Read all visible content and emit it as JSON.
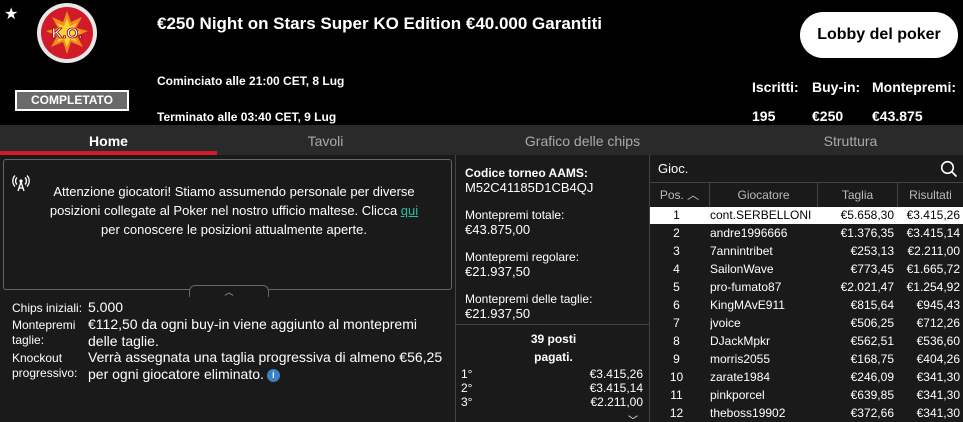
{
  "header": {
    "badge_text": "K.O.",
    "status": "COMPLETATO",
    "title": "€250 Night on Stars Super KO Edition €40.000 Garantiti",
    "started": "Cominciato alle 21:00 CET, 8 Lug",
    "ended": "Terminato alle 03:40 CET, 9 Lug",
    "lobby_button": "Lobby del poker",
    "stats": [
      {
        "label": "Iscritti:",
        "value": "195"
      },
      {
        "label": "Buy-in:",
        "value": "€250"
      },
      {
        "label": "Montepremi:",
        "value": "€43.875"
      }
    ]
  },
  "tabs": [
    "Home",
    "Tavoli",
    "Grafico delle chips",
    "Struttura"
  ],
  "notice": {
    "text_before": "Attenzione giocatori! Stiamo assumendo personale per diverse posizioni collegate al Poker nel nostro ufficio maltese. Clicca ",
    "link": "qui",
    "text_after": " per conoscere le posizioni attualmente aperte."
  },
  "info": [
    {
      "label": "Chips iniziali:",
      "value": "5.000"
    },
    {
      "label": "Montepremi taglie:",
      "value": "€112,50 da ogni buy-in viene aggiunto al montepremi delle taglie."
    },
    {
      "label": "Knockout progressivo:",
      "value": "Verrà assegnata una taglia progressiva di almeno €56,25 per ogni giocatore eliminato."
    }
  ],
  "middle": {
    "aams_label": "Codice torneo AAMS:",
    "aams_code": "M52C41185D1CB4QJ",
    "total_label": "Montepremi totale:",
    "total_value": "€43.875,00",
    "regular_label": "Montepremi regolare:",
    "regular_value": "€21.937,50",
    "bounty_label": "Montepremi delle taglie:",
    "bounty_value": "€21.937,50",
    "places_line1": "39 posti",
    "places_line2": "pagati.",
    "payouts": [
      {
        "place": "1°",
        "amount": "€3.415,26"
      },
      {
        "place": "2°",
        "amount": "€3.415,14"
      },
      {
        "place": "3°",
        "amount": "€2.211,00"
      }
    ]
  },
  "players": {
    "search_placeholder": "Gioc.",
    "columns": [
      "Pos.",
      "Giocatore",
      "Taglia",
      "Risultati"
    ],
    "rows": [
      {
        "pos": "1",
        "name": "cont.SERBELLONI",
        "bounty": "€5.658,30",
        "prize": "€3.415,26"
      },
      {
        "pos": "2",
        "name": "andre1996666",
        "bounty": "€1.376,35",
        "prize": "€3.415,14"
      },
      {
        "pos": "3",
        "name": "7annintribet",
        "bounty": "€253,13",
        "prize": "€2.211,00"
      },
      {
        "pos": "4",
        "name": "SailonWave",
        "bounty": "€773,45",
        "prize": "€1.665,72"
      },
      {
        "pos": "5",
        "name": "pro-fumato87",
        "bounty": "€2.021,47",
        "prize": "€1.254,92"
      },
      {
        "pos": "6",
        "name": "KingMAvE911",
        "bounty": "€815,64",
        "prize": "€945,43"
      },
      {
        "pos": "7",
        "name": "jvoice",
        "bounty": "€506,25",
        "prize": "€712,26"
      },
      {
        "pos": "8",
        "name": "DJackMpkr",
        "bounty": "€562,51",
        "prize": "€536,60"
      },
      {
        "pos": "9",
        "name": "morris2055",
        "bounty": "€168,75",
        "prize": "€404,26"
      },
      {
        "pos": "10",
        "name": "zarate1984",
        "bounty": "€246,09",
        "prize": "€341,30"
      },
      {
        "pos": "11",
        "name": "pinkporcel",
        "bounty": "€639,85",
        "prize": "€341,30"
      },
      {
        "pos": "12",
        "name": "theboss19902",
        "bounty": "€372,66",
        "prize": "€341,30"
      }
    ]
  },
  "colors": {
    "accent_red": "#d11a2a",
    "link_teal": "#2eb8a8",
    "background": "#000000",
    "panel": "#1a1a1a"
  }
}
